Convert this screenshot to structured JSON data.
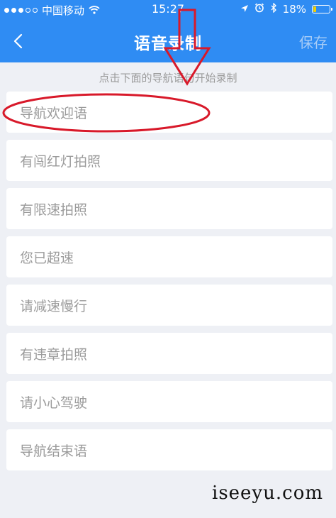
{
  "status_bar": {
    "carrier": "中国移动",
    "time": "15:27",
    "battery": "18%",
    "battery_level": 0.18,
    "icons": [
      "wifi-icon",
      "location-arrow-icon",
      "alarm-icon",
      "bluetooth-icon",
      "battery-icon"
    ]
  },
  "nav": {
    "title": "语音录制",
    "save_label": "保存",
    "back_icon": "chevron-left-icon"
  },
  "hint": "点击下面的导航语句开始录制",
  "items": [
    {
      "label": "导航欢迎语"
    },
    {
      "label": "有闯红灯拍照"
    },
    {
      "label": "有限速拍照"
    },
    {
      "label": "您已超速"
    },
    {
      "label": "请减速慢行"
    },
    {
      "label": "有违章拍照"
    },
    {
      "label": "请小心驾驶"
    },
    {
      "label": "导航结束语"
    }
  ],
  "watermark": "iseeyu.com",
  "colors": {
    "accent": "#2f8cf3",
    "annotation": "#d8192a",
    "item_text": "#9b9b9b",
    "background": "#eef0f5"
  }
}
